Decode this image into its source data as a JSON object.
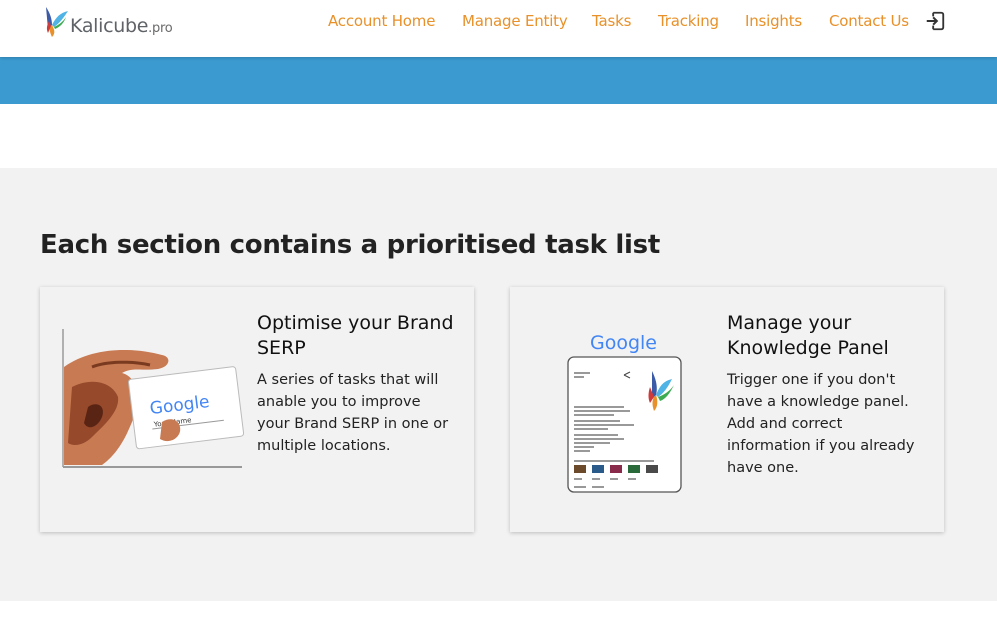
{
  "brand": {
    "name": "Kalicube",
    "suffix": ".pro"
  },
  "nav": {
    "items": [
      {
        "label": "Account Home"
      },
      {
        "label": "Manage Entity"
      },
      {
        "label": "Tasks"
      },
      {
        "label": "Tracking"
      },
      {
        "label": "Insights"
      },
      {
        "label": "Contact Us"
      }
    ],
    "logout_icon": "logout-icon"
  },
  "colors": {
    "accent": "#e8912a",
    "band": "#3b9ad0",
    "section_bg": "#f2f2f2"
  },
  "main": {
    "heading": "Each section contains a prioritised task list",
    "cards": [
      {
        "title": "Optimise your Brand SERP",
        "description": "A series of tasks that will anable you to improve your Brand SERP in one or multiple locations.",
        "image": {
          "logo_text": "Google",
          "field_text": "Your Name"
        }
      },
      {
        "title": "Manage your Knowledge Panel",
        "description": "Trigger one if you don't have a knowledge panel. Add and correct information if you already have one.",
        "image": {
          "logo_text": "Google"
        }
      }
    ]
  }
}
